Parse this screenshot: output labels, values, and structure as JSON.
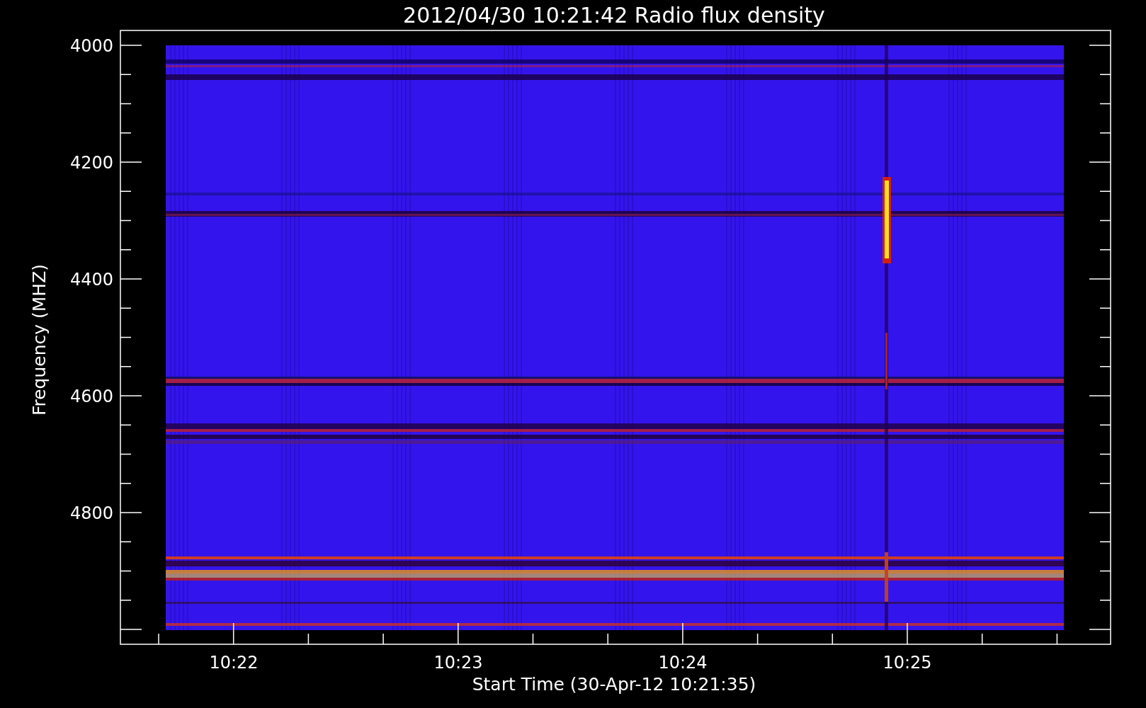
{
  "title": "2012/04/30 10:21:42 Radio flux density",
  "x_axis": {
    "label": "Start Time (30-Apr-12 10:21:35)",
    "ticks": [
      "10:22",
      "10:23",
      "10:24",
      "10:25"
    ]
  },
  "y_axis": {
    "label": "Frequency (MHZ)",
    "ticks": [
      "4000",
      "4200",
      "4400",
      "4600",
      "4800"
    ]
  }
}
